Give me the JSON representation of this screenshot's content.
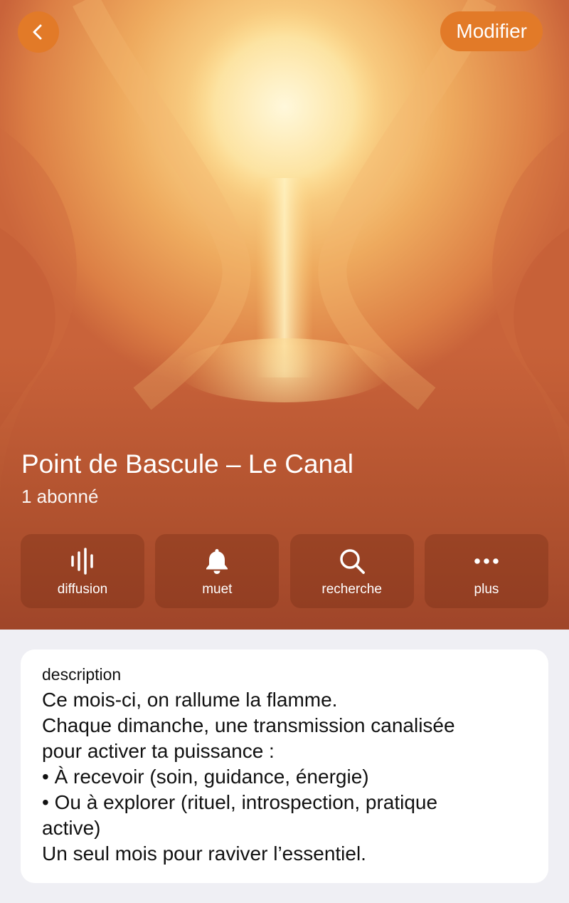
{
  "header": {
    "back_icon": "chevron-left-icon",
    "edit_label": "Modifier",
    "accent_color": "#e27a28"
  },
  "channel": {
    "name": "Point de Bascule – Le Canal",
    "subscribers": "1 abonné"
  },
  "actions": [
    {
      "label": "diffusion",
      "icon": "waveform-icon"
    },
    {
      "label": "muet",
      "icon": "bell-icon"
    },
    {
      "label": "recherche",
      "icon": "magnifier-icon"
    },
    {
      "label": "plus",
      "icon": "ellipsis-icon"
    }
  ],
  "description": {
    "caption": "description",
    "lines": [
      "Ce mois-ci, on rallume la flamme.",
      "Chaque dimanche, une transmission canalisée",
      "pour activer ta puissance :",
      "• À recevoir (soin, guidance, énergie)",
      "• Ou à explorer (rituel, introspection, pratique",
      "active)",
      "Un seul mois pour raviver l’essentiel."
    ]
  }
}
